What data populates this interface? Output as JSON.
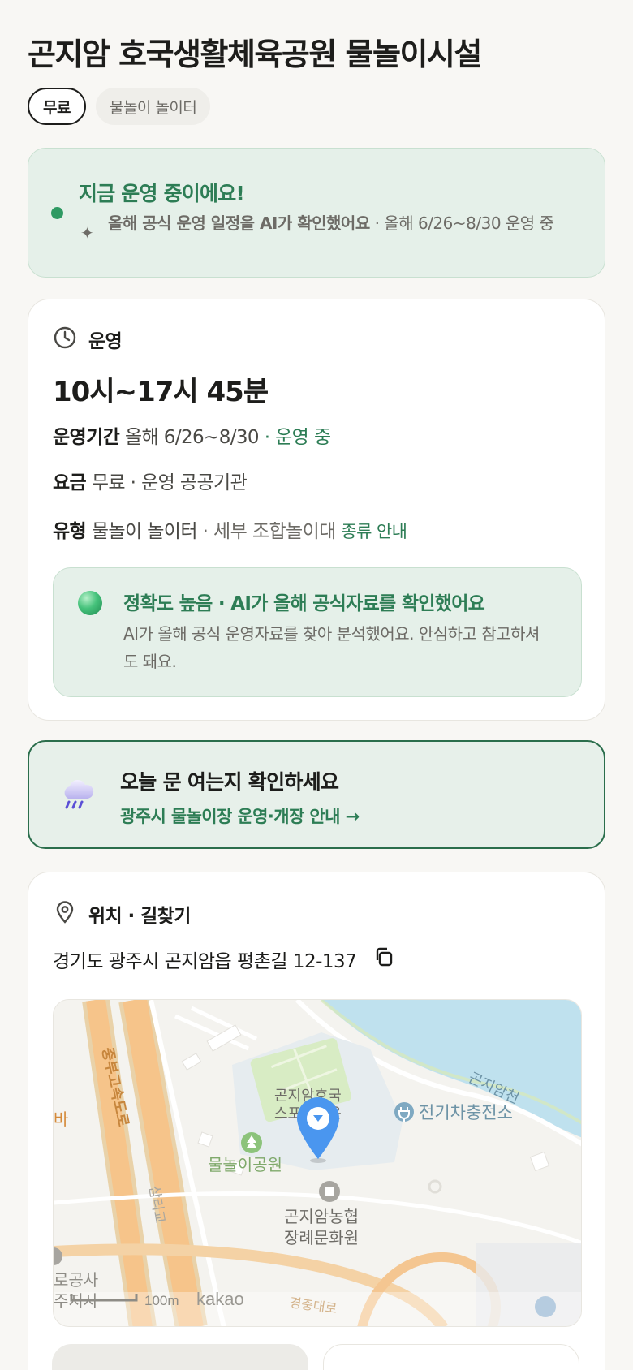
{
  "header": {
    "title": "곤지암 호국생활체육공원 물놀이시설",
    "chips": [
      "무료",
      "물놀이 놀이터"
    ]
  },
  "status": {
    "headline": "지금 운영 중이에요!",
    "ai_note": "올해 공식 운영 일정을 AI가 확인했어요",
    "period_note": " · 올해 6/26~8/30 운영 중"
  },
  "operation": {
    "section_label": "운영",
    "hours": "10시~17시 45분",
    "period_key": "운영기간",
    "period_value": "올해 6/26~8/30",
    "period_status": " · 운영 중",
    "fee_key": "요금",
    "fee_value": "무료 · 운영 공공기관",
    "type_key": "유형",
    "type_value": "물놀이 놀이터",
    "type_detail": " · 세부 조합놀이대",
    "type_link": "종류 안내",
    "accuracy_title": "정확도 높음 · AI가 올해 공식자료를 확인했어요",
    "accuracy_desc": "AI가 올해 공식 운영자료를 찾아 분석했어요. 안심하고 참고하셔도 돼요."
  },
  "today_check": {
    "title": "오늘 문 여는지 확인하세요",
    "link": "광주시 물놀이장 운영·개장 안내 →"
  },
  "location": {
    "section_label": "위치 · 길찾기",
    "address": "경기도 광주시 곤지암읍 평촌길 12-137",
    "map": {
      "labels": {
        "highway": "중부고속도로",
        "road": "삼리교",
        "stream": "곤지암천",
        "ev": "전기차충전소",
        "town1": "곤지암호국",
        "town2": "스포츠타운",
        "park": "물놀이공원",
        "hall1": "곤지암농협",
        "hall2": "장례문화원",
        "corp1": "로공사",
        "corp2": "주지사",
        "left_edge": "바",
        "road2": "경충대로",
        "scale": "100m",
        "brand": "kakao"
      }
    }
  },
  "colors": {
    "accent": "#2d7d55",
    "status_bg": "#e5f0e9",
    "page_bg": "#f8f7f4"
  }
}
